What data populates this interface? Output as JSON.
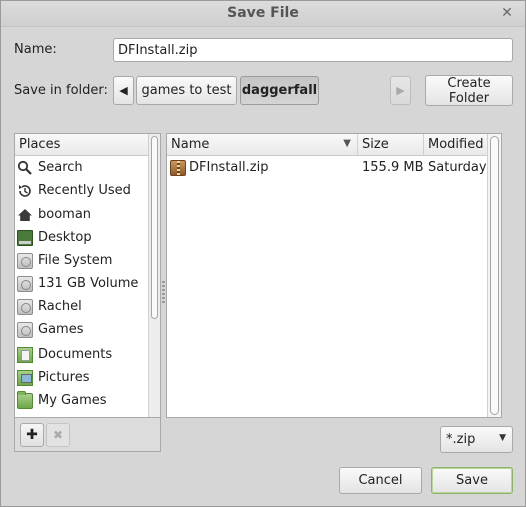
{
  "window": {
    "title": "Save File"
  },
  "name_field": {
    "label": "Name:",
    "value": "DFInstall.zip"
  },
  "folder_bar": {
    "label": "Save in folder:",
    "crumbs": [
      {
        "label": "games to test",
        "selected": false
      },
      {
        "label": "daggerfall",
        "selected": true
      }
    ],
    "create_folder_label": "Create Folder"
  },
  "places": {
    "header": "Places",
    "items": [
      {
        "label": "Search",
        "icon": "search-icon"
      },
      {
        "label": "Recently Used",
        "icon": "recent-icon"
      },
      {
        "label": "booman",
        "icon": "home-icon"
      },
      {
        "label": "Desktop",
        "icon": "desktop-icon"
      },
      {
        "label": "File System",
        "icon": "drive-icon"
      },
      {
        "label": "131 GB Volume",
        "icon": "drive-icon"
      },
      {
        "label": "Rachel",
        "icon": "drive-icon"
      },
      {
        "label": "Games",
        "icon": "drive-icon"
      },
      {
        "label": "Documents",
        "icon": "documents-folder-icon"
      },
      {
        "label": "Pictures",
        "icon": "pictures-folder-icon"
      },
      {
        "label": "My Games",
        "icon": "folder-icon"
      }
    ]
  },
  "files": {
    "columns": {
      "name": "Name",
      "size": "Size",
      "modified": "Modified"
    },
    "rows": [
      {
        "name": "DFInstall.zip",
        "size": "155.9 MB",
        "modified": "Saturday",
        "icon": "zip-archive-icon"
      }
    ]
  },
  "filter": {
    "value": "*.zip"
  },
  "buttons": {
    "cancel": "Cancel",
    "save": "Save"
  },
  "colors": {
    "dialog_bg": "#d6d6d6",
    "default_button_accent": "#8fb36a"
  }
}
